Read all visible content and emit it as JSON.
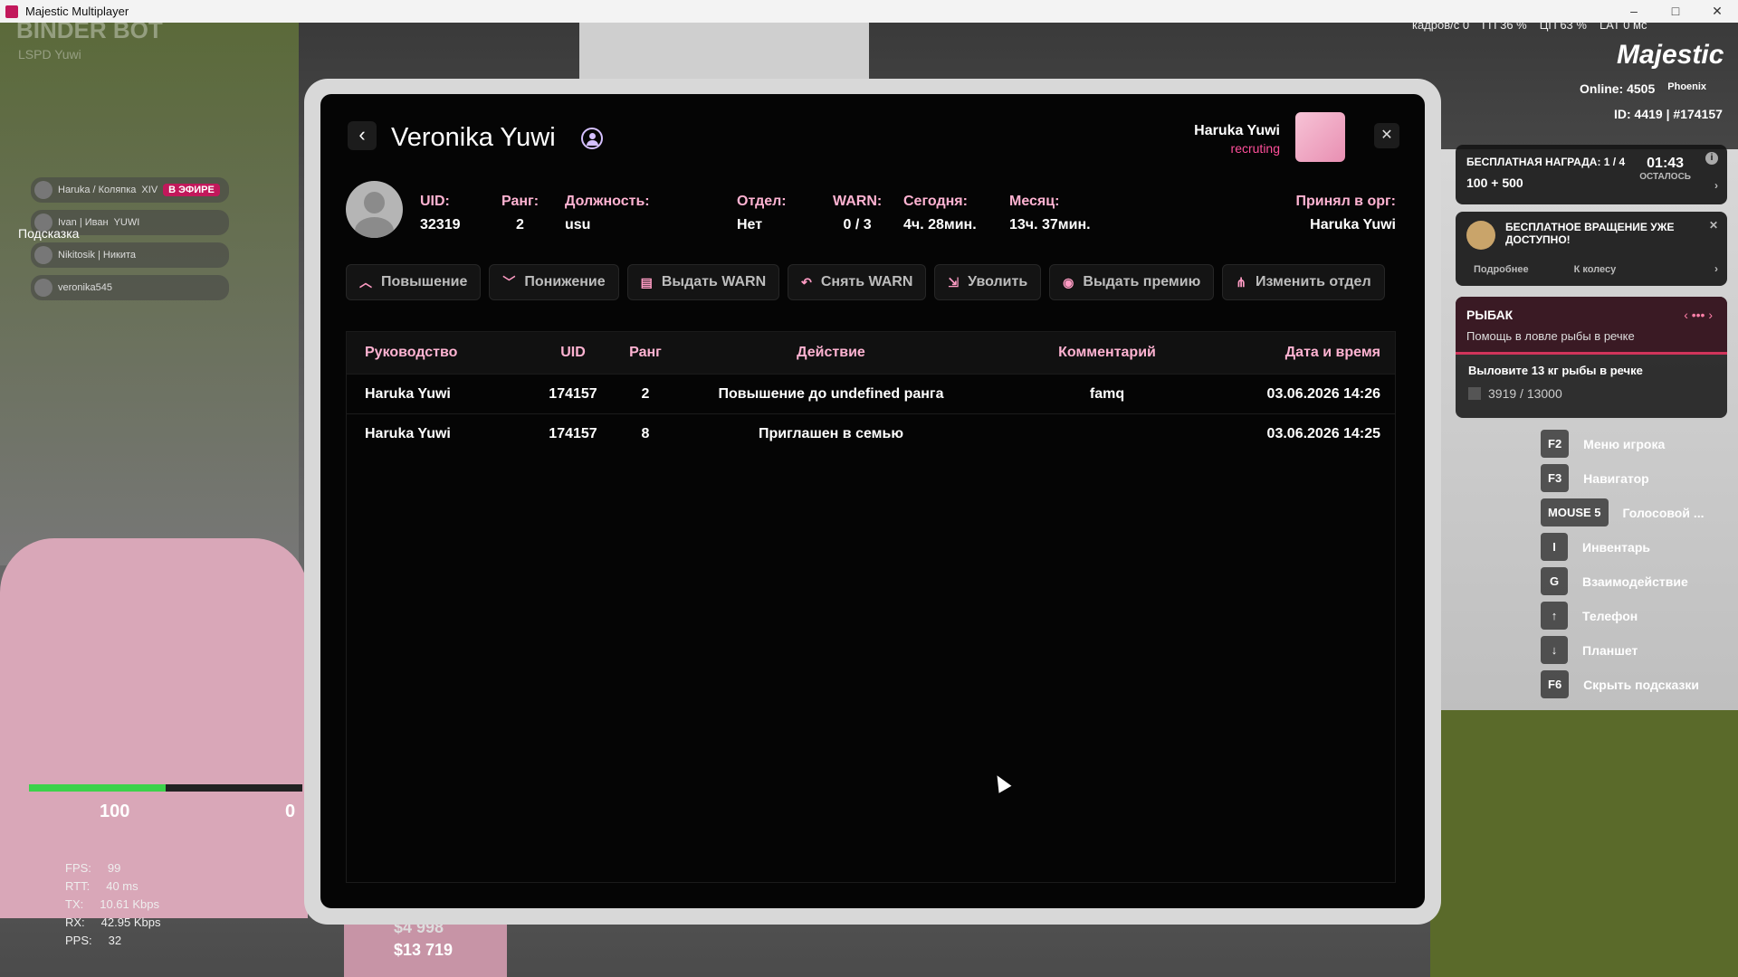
{
  "window": {
    "title": "Majestic Multiplayer",
    "minimize": "–",
    "maximize": "□",
    "close": "✕"
  },
  "hud": {
    "top_stats": [
      "кадров/с  0",
      "ГП 36 %",
      "ЦП 63 %",
      "LAT 0 мс"
    ],
    "logo": "Majestic",
    "online": "Online: 4505",
    "server": "Phoenix",
    "ids": "ID: 4419 | #174157",
    "binder": "BINDER BOT",
    "lspd": "LSPD Yuwi",
    "hint": "Подсказка",
    "voice": [
      {
        "name": "Haruka / Коляпка",
        "tag": "XIV",
        "badge": "В ЭФИРЕ"
      },
      {
        "name": "Ivan | Иван",
        "tag": "YUWI",
        "badge": ""
      },
      {
        "name": "Nikitosik | Никита",
        "tag": "",
        "badge": ""
      },
      {
        "name": "veronika545",
        "tag": "",
        "badge": ""
      }
    ],
    "health": 0.5,
    "speed": "100",
    "zero": "0",
    "net": [
      {
        "k": "FPS:",
        "v": "99"
      },
      {
        "k": "RTT:",
        "v": "40 ms"
      },
      {
        "k": "TX:",
        "v": "10.61 Kbps"
      },
      {
        "k": "RX:",
        "v": "42.95 Kbps"
      },
      {
        "k": "PPS:",
        "v": "32"
      }
    ],
    "money_cash": "$4 998",
    "money_bank": "$13 719"
  },
  "right": {
    "reward_line1": "БЕСПЛАТНАЯ НАГРАДА: 1 / 4",
    "reward_line2": "100  +  500",
    "reward_timer": "01:43",
    "reward_timer_label": "ОСТАЛОСЬ",
    "spin_text": "БЕСПЛАТНОЕ ВРАЩЕНИЕ УЖЕ ДОСТУПНО!",
    "spin_more": "Подробнее",
    "spin_wheel": "К колесу",
    "quest_title": "РЫБАК",
    "quest_sub": "Помощь в ловле рыбы в речке",
    "quest_task": "Выловите 13 кг рыбы в речке",
    "quest_progress": "3919 / 13000",
    "keys": [
      {
        "k": "F2",
        "label": "Меню игрока"
      },
      {
        "k": "F3",
        "label": "Навигатор"
      },
      {
        "k": "MOUSE 5",
        "label": "Голосовой ..."
      },
      {
        "k": "I",
        "label": "Инвентарь"
      },
      {
        "k": "G",
        "label": "Взаимодействие"
      },
      {
        "k": "↑",
        "label": "Телефон"
      },
      {
        "k": "↓",
        "label": "Планшет"
      },
      {
        "k": "F6",
        "label": "Скрыть подсказки"
      }
    ]
  },
  "panel": {
    "back": "‹",
    "title": "Veronika Yuwi",
    "me_name": "Haruka Yuwi",
    "me_role": "recruting",
    "close": "✕",
    "profile": {
      "uid_label": "UID:",
      "uid": "32319",
      "rank_label": "Ранг:",
      "rank": "2",
      "position_label": "Должность:",
      "position": "usu",
      "dept_label": "Отдел:",
      "dept": "Нет",
      "warn_label": "WARN:",
      "warn": "0 / 3",
      "today_label": "Сегодня:",
      "today": "4ч. 28мин.",
      "month_label": "Месяц:",
      "month": "13ч. 37мин.",
      "accepted_label": "Принял в орг:",
      "accepted": "Haruka Yuwi"
    },
    "actions": [
      {
        "icon": "︿",
        "label": "Повышение",
        "name": "promote-button",
        "iname": "chevron-up-icon"
      },
      {
        "icon": "﹀",
        "label": "Понижение",
        "name": "demote-button",
        "iname": "chevron-down-icon"
      },
      {
        "icon": "▤",
        "label": "Выдать WARN",
        "name": "give-warn-button",
        "iname": "document-warning-icon"
      },
      {
        "icon": "↶",
        "label": "Снять WARN",
        "name": "remove-warn-button",
        "iname": "undo-icon"
      },
      {
        "icon": "⇲",
        "label": "Уволить",
        "name": "fire-button",
        "iname": "exit-door-icon"
      },
      {
        "icon": "◉",
        "label": "Выдать премию",
        "name": "give-bonus-button",
        "iname": "coin-icon"
      },
      {
        "icon": "⋔",
        "label": "Изменить отдел",
        "name": "change-dept-button",
        "iname": "hierarchy-icon"
      }
    ],
    "table": {
      "headers": [
        "Руководство",
        "UID",
        "Ранг",
        "Действие",
        "Комментарий",
        "Дата и время"
      ],
      "rows": [
        [
          "Haruka Yuwi",
          "174157",
          "2",
          "Повышение до undefined ранга",
          "famq",
          "03.06.2026 14:26"
        ],
        [
          "Haruka Yuwi",
          "174157",
          "8",
          "Приглашен в семью",
          "",
          "03.06.2026 14:25"
        ]
      ]
    }
  }
}
